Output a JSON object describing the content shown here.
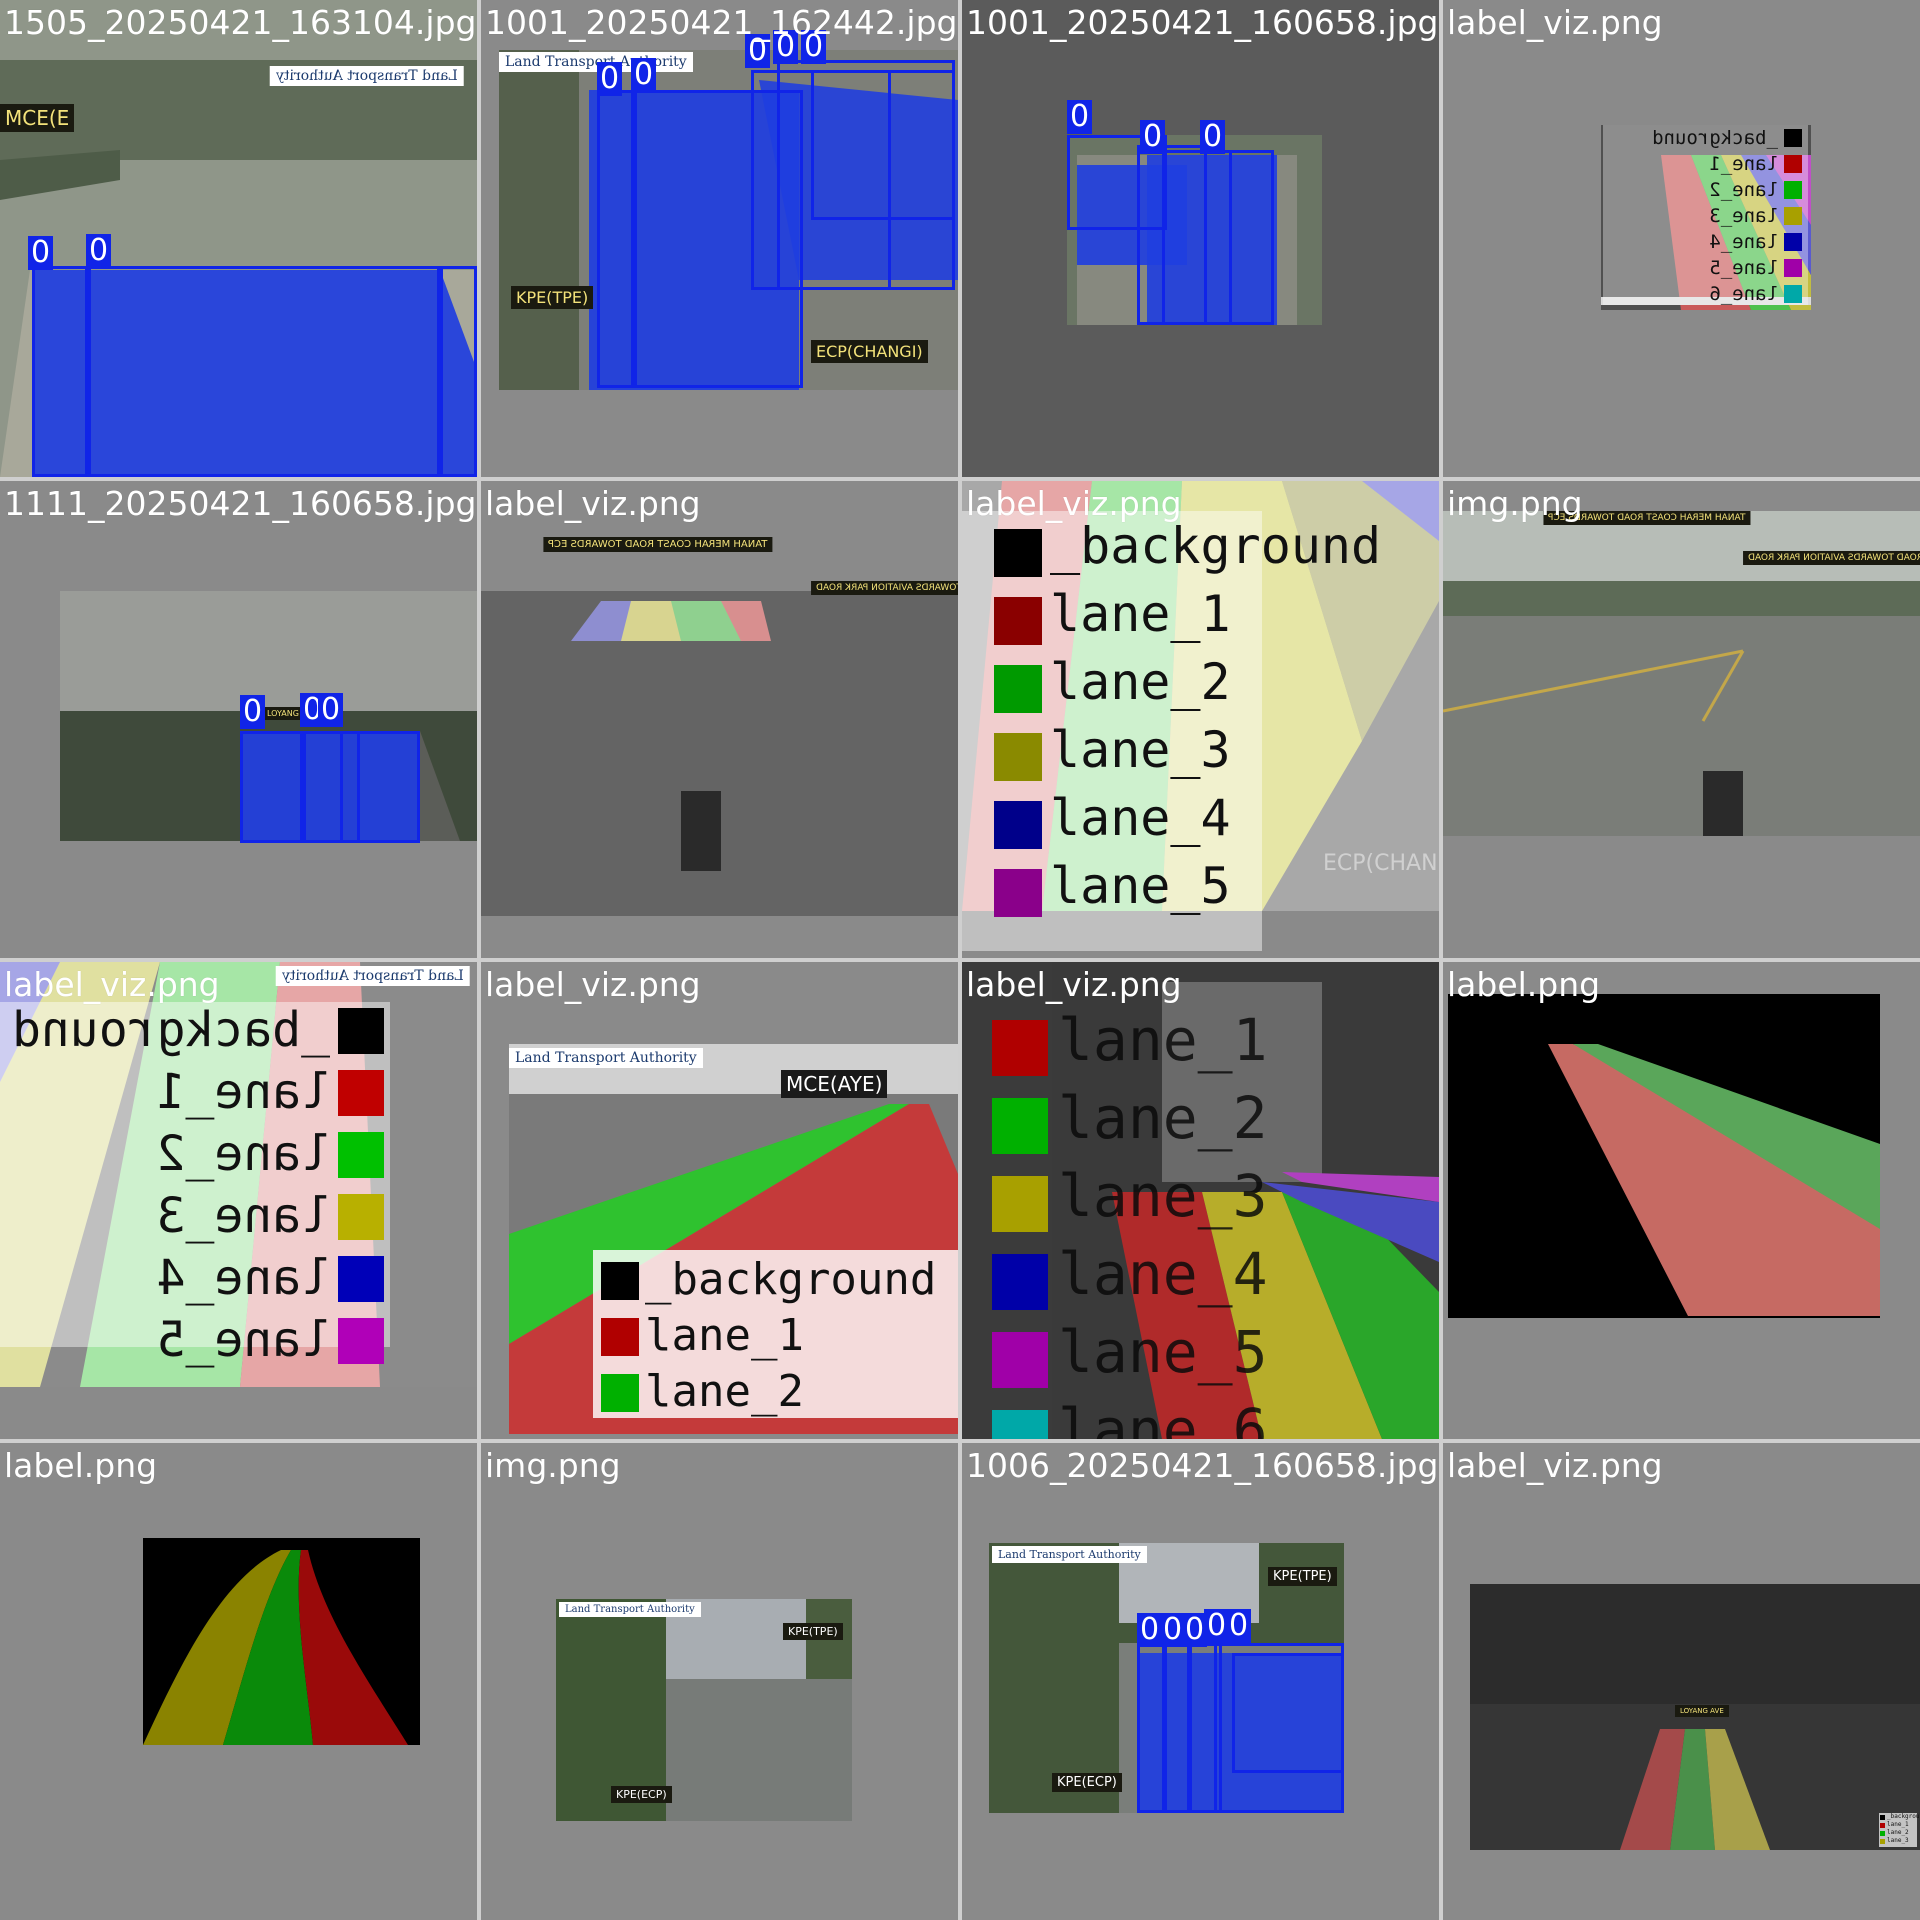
{
  "tiles": [
    {
      "title": "1505_20250421_163104.jpg"
    },
    {
      "title": "1001_20250421_162442.jpg"
    },
    {
      "title": "1001_20250421_160658.jpg"
    },
    {
      "title": "label_viz.png"
    },
    {
      "title": "1111_20250421_160658.jpg"
    },
    {
      "title": "label_viz.png"
    },
    {
      "title": "label_viz.png"
    },
    {
      "title": "img.png"
    },
    {
      "title": "label_viz.png"
    },
    {
      "title": "label_viz.png"
    },
    {
      "title": "label_viz.png"
    },
    {
      "title": "label.png"
    },
    {
      "title": "label.png"
    },
    {
      "title": "img.png"
    },
    {
      "title": "1006_20250421_160658.jpg"
    },
    {
      "title": "label_viz.png"
    }
  ],
  "box_label": "0",
  "labels": {
    "background": "_background",
    "lane_1": "lane_1",
    "lane_2": "lane_2",
    "lane_3": "lane_3",
    "lane_4": "lane_4",
    "lane_5": "lane_5",
    "lane_6": "lane_6"
  },
  "signs": {
    "mce": "MCE(E",
    "kpe_tpe": "KPE(TPE)",
    "ecp_changi": "ECP(CHANGI)",
    "mce_aye": "MCE(AYE)",
    "kpe_ecp": "KPE(ECP)",
    "ecp_chan": "ECP(CHAN",
    "tanah_merah": "TANAH MERAH COAST ROAD TOWARDS ECP",
    "aviation": "TANAH MERAH COAST ROAD TOWARDS AVIATION PARK ROAD",
    "loyang": "LOYANG AVE"
  },
  "logo": "Land Transport Authority",
  "colors": {
    "box": "#1024e8",
    "lane_1": "#b00000",
    "lane_2": "#00b000",
    "lane_3": "#a8a000",
    "lane_4": "#0000a8",
    "lane_5": "#a000a8",
    "lane_6": "#00a8a8",
    "background": "#000000",
    "tile_bg_light": "#8a8a8a",
    "tile_bg_dark": "#5b5b5b"
  }
}
